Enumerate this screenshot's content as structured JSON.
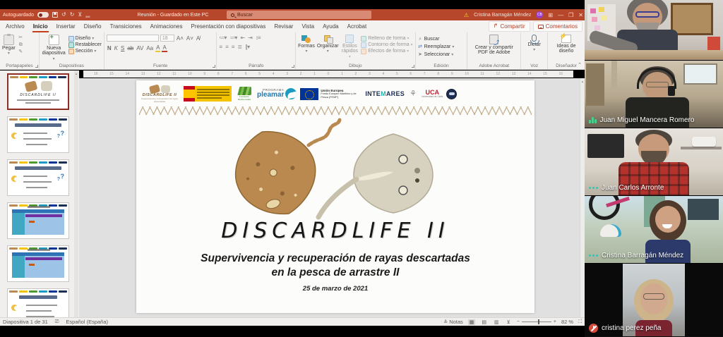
{
  "titlebar": {
    "autosave_label": "Autoguardado",
    "doc_title": "Reunión  -  Guardado en Este PC",
    "search_placeholder": "Buscar",
    "user_name": "Cristina Barragán Méndez",
    "user_initials": "CB"
  },
  "ribbon_tabs": [
    "Archivo",
    "Inicio",
    "Insertar",
    "Diseño",
    "Transiciones",
    "Animaciones",
    "Presentación con diapositivas",
    "Revisar",
    "Vista",
    "Ayuda",
    "Acrobat"
  ],
  "active_tab": "Inicio",
  "actions": {
    "share": "Compartir",
    "comments": "Comentarios"
  },
  "ribbon": {
    "paste": "Pegar",
    "new_slide": "Nueva diapositiva",
    "design": "Diseño",
    "reset": "Restablecer",
    "section": "Sección",
    "font_size": "18",
    "bold": "N",
    "italic": "K",
    "underline": "S",
    "strike": "ab",
    "char_spacing": "AV",
    "change_case": "Aa",
    "shapes": "Formas",
    "arrange": "Organizar",
    "quick_styles": "Estilos rápidos",
    "shape_fill": "Relleno de forma",
    "shape_outline": "Contorno de forma",
    "shape_effects": "Efectos de forma",
    "find": "Buscar",
    "replace": "Reemplazar",
    "select": "Seleccionar",
    "adobe_pdf": "Crear y compartir PDF de Adobe",
    "dictate": "Dictar",
    "design_ideas": "Ideas de diseño",
    "groups": [
      "Portapapeles",
      "Diapositivas",
      "Fuente",
      "Párrafo",
      "Dibujo",
      "Edición",
      "Adobe Acrobat",
      "Voz",
      "Diseñador"
    ]
  },
  "ruler_numbers": [
    16,
    15,
    14,
    13,
    12,
    11,
    10,
    9,
    8,
    7,
    6,
    5,
    4,
    3,
    2,
    1,
    0,
    1,
    2,
    3,
    4,
    5,
    6,
    7,
    8,
    9,
    10,
    11,
    12,
    13,
    14,
    15,
    16
  ],
  "thumbnails": [
    {
      "kind": "title",
      "selected": true
    },
    {
      "kind": "bullets",
      "selected": false
    },
    {
      "kind": "bullets",
      "selected": false
    },
    {
      "kind": "gantt",
      "selected": false
    },
    {
      "kind": "gantt",
      "selected": false
    },
    {
      "kind": "bullets2",
      "selected": false
    }
  ],
  "slide": {
    "title": "DISCARDLIFE II",
    "subtitle_line1": "Supervivencia y recuperación de rayas descartadas",
    "subtitle_line2": "en la pesca de arrastre II",
    "date": "25 de marzo de 2021",
    "logos": {
      "discardlife": "DISCARDLIFE II",
      "discardlife_tag": "Supervivencia y recuperación de rayas descartadas",
      "biodiversidad": "Fundación Biodiversidad",
      "programa": "PROGRAMA",
      "pleamar": "pleamar",
      "eu_title": "Unión Europea",
      "eu_sub": "Fondo Europeo Marítimo y de Pesca (FEMP)",
      "intemares_pre": "INTE",
      "intemares_m": "M",
      "intemares_post": "ARES",
      "uca": "UCA",
      "uca_sub": "Universidad de Cádiz"
    }
  },
  "statusbar": {
    "slide_counter": "Diapositiva 1 de 31",
    "language": "Español (España)",
    "notes": "Notas",
    "zoom": "82 %"
  },
  "participants": [
    {
      "name": "",
      "indicator": "none"
    },
    {
      "name": "Juan Miguel Mancera Romero",
      "indicator": "speaking"
    },
    {
      "name": "Juan Carlos Arronte",
      "indicator": "dots"
    },
    {
      "name": "Cristina Barragán Méndez",
      "indicator": "dots"
    },
    {
      "name": "cristina perez peña",
      "indicator": "muted"
    }
  ],
  "colors": {
    "titlebar": "#b7472a",
    "active_tab_underline": "#c43e1c",
    "speaking_indicator": "#4ccf8e",
    "dots_indicator": "#35c4b5",
    "muted_mic": "#d84a3e",
    "avatar": "#9a3fc7"
  }
}
